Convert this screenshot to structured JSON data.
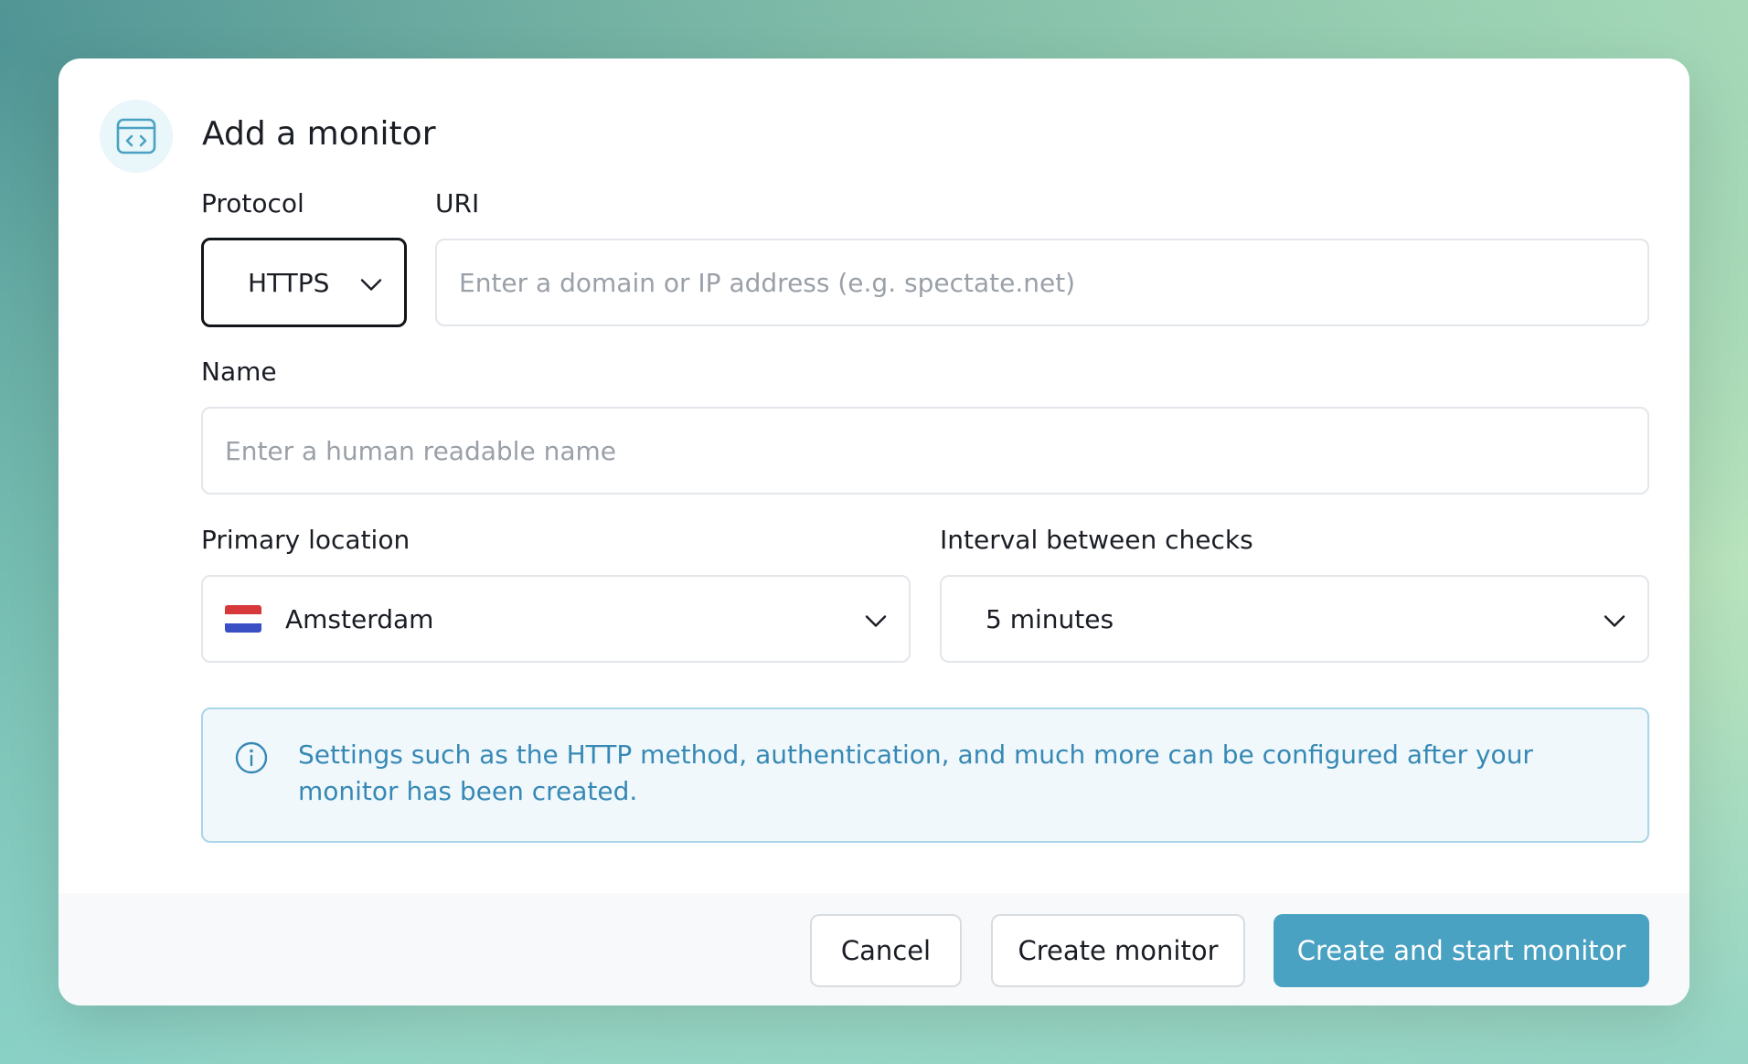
{
  "dialog": {
    "title": "Add a monitor",
    "icon": "code-window-icon"
  },
  "form": {
    "protocol": {
      "label": "Protocol",
      "value": "HTTPS"
    },
    "uri": {
      "label": "URI",
      "placeholder": "Enter a domain or IP address (e.g. spectate.net)"
    },
    "name": {
      "label": "Name",
      "placeholder": "Enter a human readable name"
    },
    "location": {
      "label": "Primary location",
      "value": "Amsterdam",
      "flag_colors": [
        "#d7393b",
        "#ffffff",
        "#3b4fc4"
      ]
    },
    "interval": {
      "label": "Interval between checks",
      "value": "5 minutes"
    }
  },
  "info": {
    "icon": "info-icon",
    "text": "Settings such as the HTTP method, authentication, and much more can be configured after your monitor has been created."
  },
  "footer": {
    "cancel_label": "Cancel",
    "create_label": "Create monitor",
    "create_start_label": "Create and start monitor"
  },
  "colors": {
    "accent": "#4aa2c2",
    "info_text": "#3789b5",
    "info_border": "#a9d5e6",
    "info_bg": "#f1f8fb"
  }
}
